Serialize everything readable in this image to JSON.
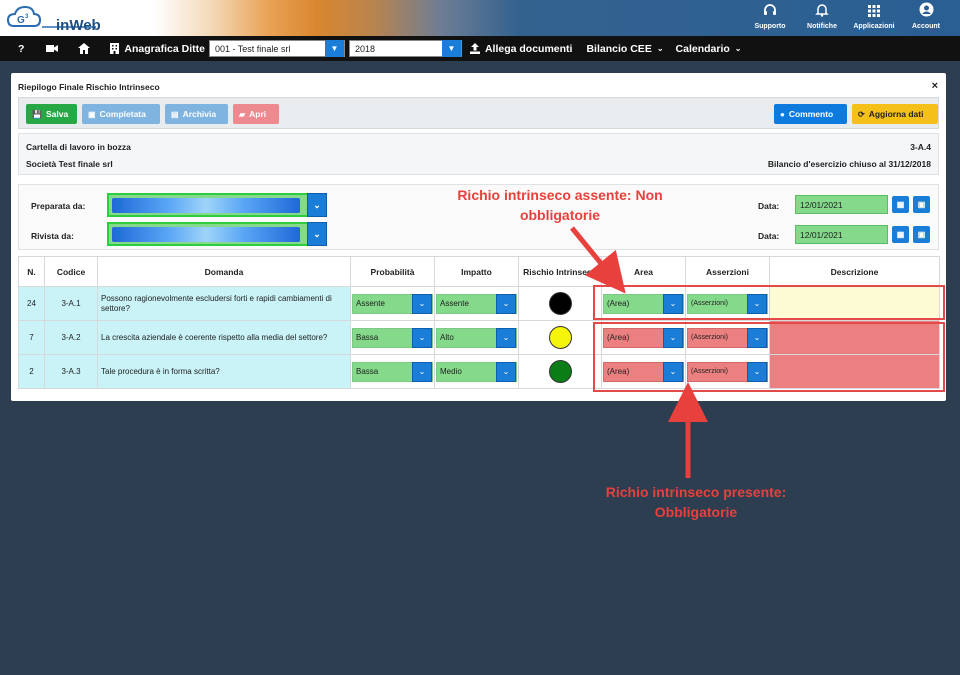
{
  "app": {
    "logo_text": "inWeb"
  },
  "top_icons": [
    {
      "label": "Supporto",
      "icon": "headset-icon",
      "glyph": "🎧"
    },
    {
      "label": "Notifiche",
      "icon": "bell-icon",
      "glyph": "🔔"
    },
    {
      "label": "Applicazioni",
      "icon": "grid-icon",
      "glyph": "▦"
    },
    {
      "label": "Account",
      "icon": "user-circle-icon",
      "glyph": "●"
    }
  ],
  "nav": {
    "help": "?",
    "company_label": "Anagrafica Ditte",
    "company_value": "001 - Test finale srl",
    "year_value": "2018",
    "upload_label": "Allega documenti",
    "bilancio_label": "Bilancio CEE",
    "calendario_label": "Calendario"
  },
  "panel": {
    "title": "Riepilogo Finale Rischio Intrinseco",
    "close": "×",
    "buttons": {
      "salva": "Salva",
      "completata": "Completata",
      "archivia": "Archivia",
      "apri": "Apri",
      "commento": "Commento",
      "aggiorna": "Aggiorna dati"
    },
    "info": {
      "status": "Cartella di lavoro in bozza",
      "company": "Società Test finale srl",
      "code": "3-A.4",
      "period": "Bilancio d'esercizio chiuso al 31/12/2018"
    },
    "people": {
      "preparata_label": "Preparata da:",
      "rivista_label": "Rivista da:",
      "data_label": "Data:",
      "data1": "12/01/2021",
      "data2": "12/01/2021"
    },
    "table": {
      "headers": [
        "N.",
        "Codice",
        "Domanda",
        "Probabilità",
        "Impatto",
        "Rischio Intrinseco",
        "Area",
        "Asserzioni",
        "Descrizione"
      ],
      "rows": [
        {
          "n": "24",
          "code": "3-A.1",
          "question": "Possono ragionevolmente escludersi forti e rapidi cambiamenti di settore?",
          "prob": "Assente",
          "impact": "Assente",
          "risk_color": "#000000",
          "area": "(Area)",
          "assertions": "(Asserzioni)",
          "required": false
        },
        {
          "n": "7",
          "code": "3-A.2",
          "question": "La crescita aziendale è coerente rispetto alla media del settore?",
          "prob": "Bassa",
          "impact": "Alto",
          "risk_color": "#f5f50a",
          "area": "(Area)",
          "assertions": "(Asserzioni)",
          "required": true
        },
        {
          "n": "2",
          "code": "3-A.3",
          "question": "Tale procedura è in forma scritta?",
          "prob": "Bassa",
          "impact": "Medio",
          "risk_color": "#0a7d16",
          "area": "(Area)",
          "assertions": "(Asserzioni)",
          "required": true
        }
      ]
    }
  },
  "annotations": {
    "top": "Richio intrinseco assente: Non obbligatorie",
    "bottom": "Richio intrinseco presente: Obbligatorie"
  }
}
